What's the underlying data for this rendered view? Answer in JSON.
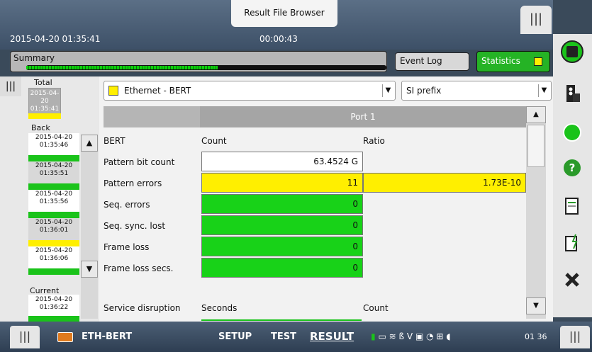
{
  "window": {
    "title": "Result File Browser",
    "datetime": "2015-04-20 01:35:41",
    "elapsed": "00:00:43"
  },
  "summary": {
    "label": "Summary"
  },
  "tabs": {
    "event_log": "Event Log",
    "statistics": "Statistics"
  },
  "left": {
    "total_label": "Total",
    "total_time": "2015-04-20\n01:35:41",
    "back_label": "Back",
    "history": [
      {
        "time": "2015-04-20\n01:35:46",
        "status": "green"
      },
      {
        "time": "2015-04-20\n01:35:51",
        "status": "green"
      },
      {
        "time": "2015-04-20\n01:35:56",
        "status": "green"
      },
      {
        "time": "2015-04-20\n01:36:01",
        "status": "yellow"
      },
      {
        "time": "2015-04-20\n01:36:06",
        "status": "green"
      }
    ],
    "current_label": "Current",
    "current_time": "2015-04-20\n01:36:22"
  },
  "filters": {
    "measurement": "Ethernet - BERT",
    "prefix": "SI prefix"
  },
  "grid": {
    "port": "Port 1",
    "col_label": "BERT",
    "col_count": "Count",
    "col_ratio": "Ratio",
    "rows": [
      {
        "label": "Pattern bit count",
        "count": "63.4524 G",
        "ratio": "",
        "count_color": "white"
      },
      {
        "label": "Pattern errors",
        "count": "11",
        "ratio": "1.73E-10",
        "count_color": "yellow"
      },
      {
        "label": "Seq. errors",
        "count": "0",
        "ratio": "",
        "count_color": "green"
      },
      {
        "label": "Seq. sync. lost",
        "count": "0",
        "ratio": "",
        "count_color": "green"
      },
      {
        "label": "Frame loss",
        "count": "0",
        "ratio": "",
        "count_color": "green"
      },
      {
        "label": "Frame loss secs.",
        "count": "0",
        "ratio": "",
        "count_color": "green"
      }
    ],
    "service_label": "Service disruption",
    "service_col1": "Seconds",
    "service_col2": "Count"
  },
  "bottom": {
    "app": "ETH-BERT",
    "setup": "SETUP",
    "test": "TEST",
    "result": "RESULT",
    "time": "01 36"
  },
  "colors": {
    "green": "#18d218",
    "yellow": "#ffef00",
    "accent": "#25b325"
  }
}
